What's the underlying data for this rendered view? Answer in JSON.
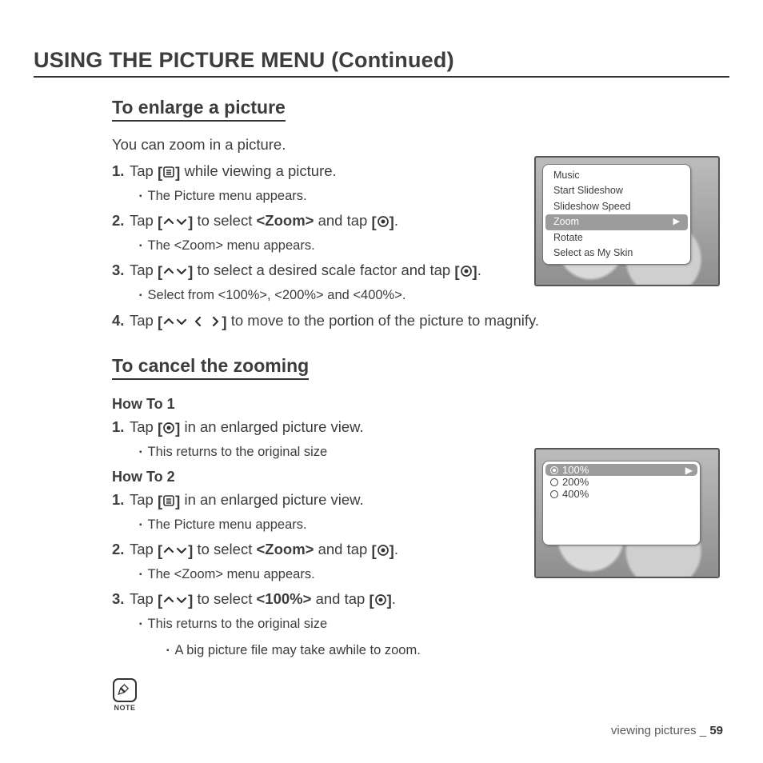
{
  "title": "USING THE PICTURE MENU (Continued)",
  "sec1": {
    "heading": "To enlarge a picture",
    "intro": "You can zoom in a picture.",
    "steps": {
      "s1": {
        "n": "1.",
        "a": "Tap ",
        "b": " while viewing a picture.",
        "sub": "The Picture menu appears."
      },
      "s2": {
        "n": "2.",
        "a": "Tap ",
        "b": " to select ",
        "zoom": "<Zoom>",
        "c": " and tap ",
        "d": ".",
        "sub": "The <Zoom> menu appears."
      },
      "s3": {
        "n": "3.",
        "a": "Tap ",
        "b": " to select a desired scale factor and tap ",
        "c": ".",
        "sub": "Select from <100%>, <200%> and <400%>."
      },
      "s4": {
        "n": "4.",
        "a": "Tap ",
        "b": " to move to the portion of the picture to magnify."
      }
    }
  },
  "sec2": {
    "heading": "To cancel the zooming",
    "how1": "How To 1",
    "how2": "How To 2",
    "h1s1": {
      "n": "1.",
      "a": "Tap ",
      "b": " in an enlarged picture view.",
      "sub": "This returns to the original size"
    },
    "h2s1": {
      "n": "1.",
      "a": "Tap ",
      "b": " in an enlarged picture view.",
      "sub": "The Picture menu appears."
    },
    "h2s2": {
      "n": "2.",
      "a": "Tap ",
      "b": " to select ",
      "zoom": "<Zoom>",
      "c": " and tap ",
      "d": ".",
      "sub": "The <Zoom> menu appears."
    },
    "h2s3": {
      "n": "3.",
      "a": "Tap ",
      "b": " to select ",
      "pct": "<100%>",
      "c": " and tap ",
      "d": ".",
      "sub": "This returns to the original size"
    },
    "note": "A big picture file may take awhile to zoom."
  },
  "menu": {
    "items": [
      "Music",
      "Start Slideshow",
      "Slideshow Speed",
      "Zoom",
      "Rotate",
      "Select as My Skin"
    ],
    "selected": "Zoom"
  },
  "zoom_options": {
    "items": [
      "100%",
      "200%",
      "400%"
    ],
    "selected": "100%"
  },
  "noteLabel": "NOTE",
  "footer": {
    "section": "viewing pictures _ ",
    "page": "59"
  }
}
